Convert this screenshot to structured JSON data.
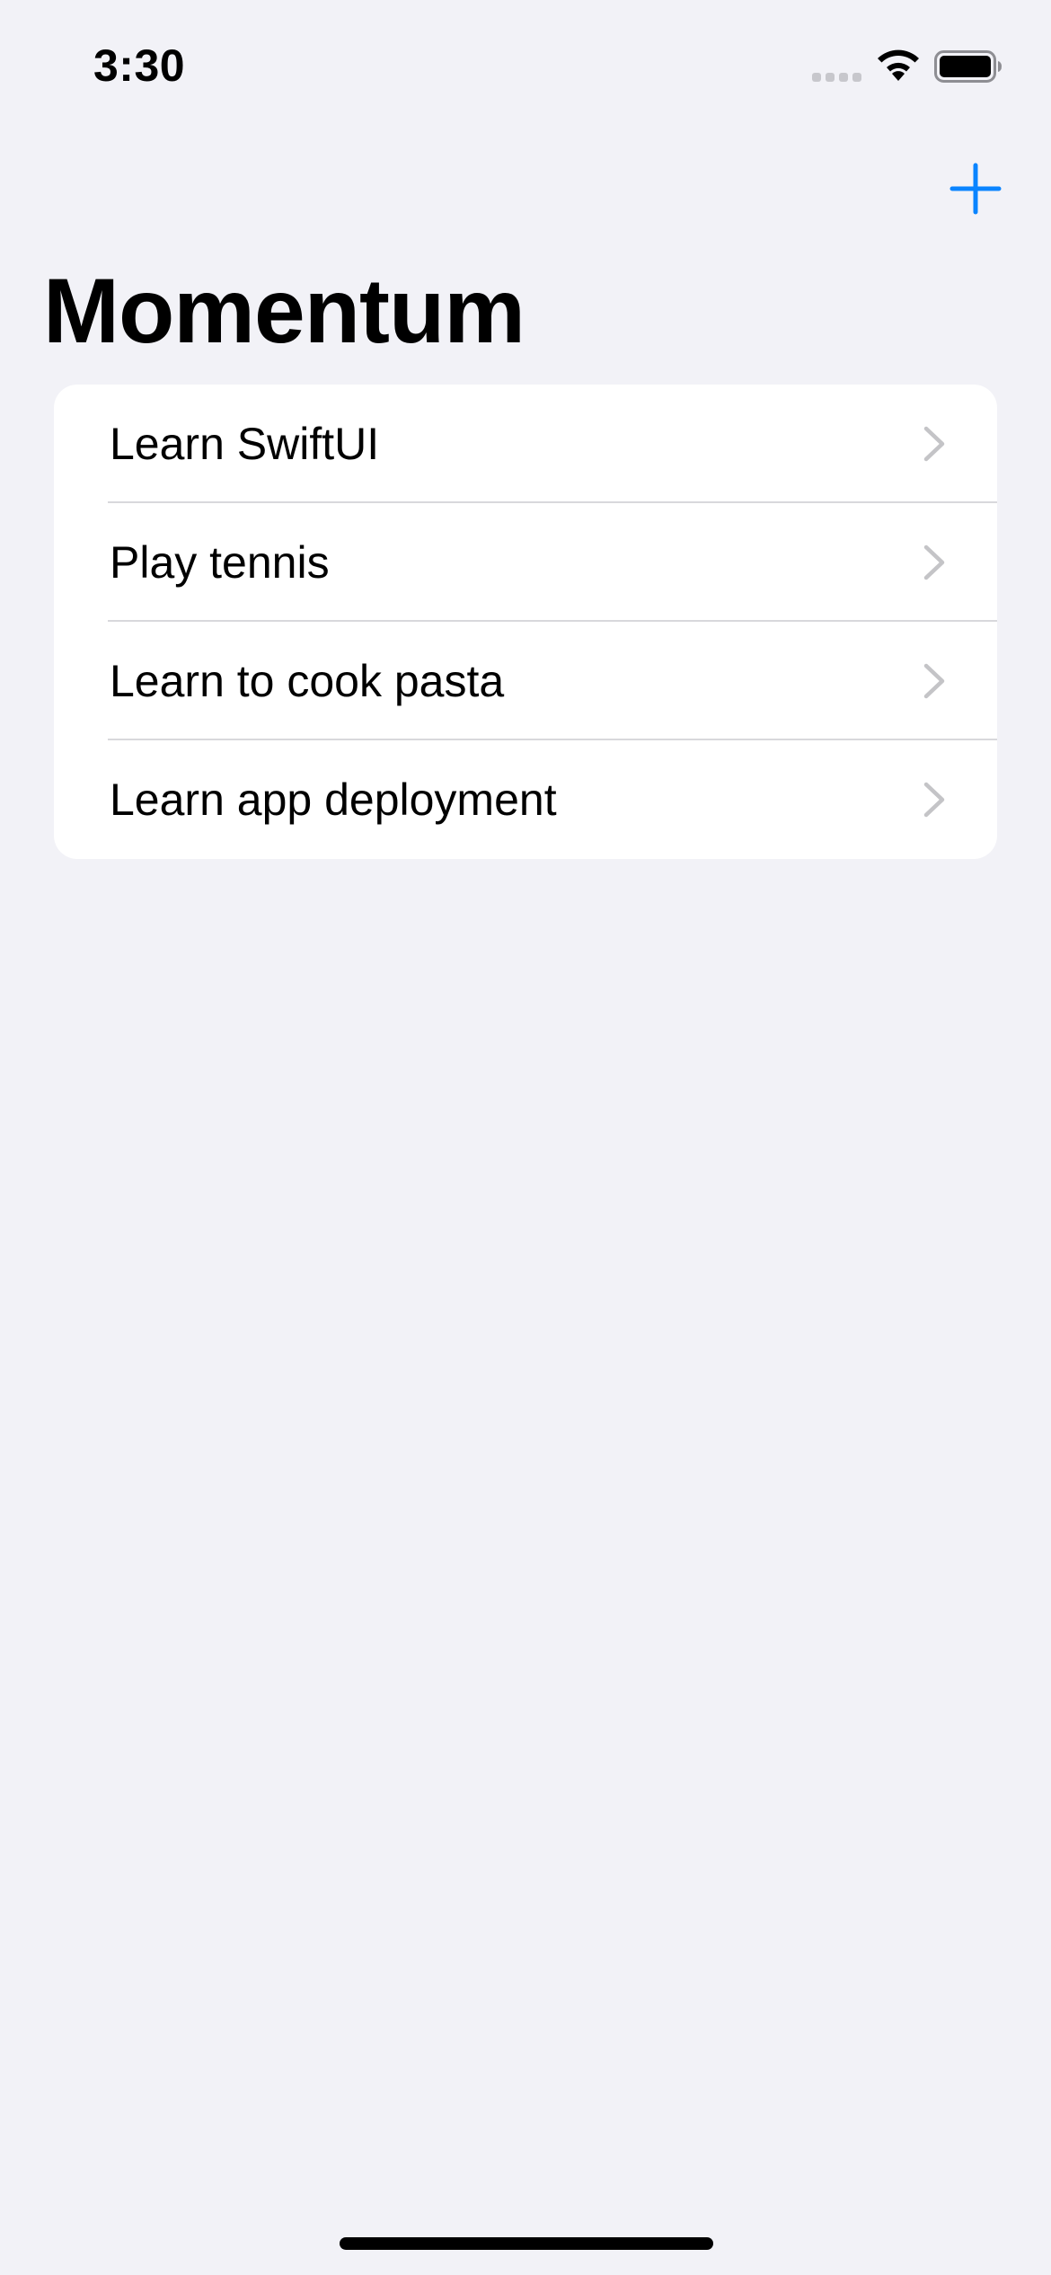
{
  "status_bar": {
    "time": "3:30"
  },
  "navigation": {
    "title": "Momentum",
    "add_icon": "plus-icon"
  },
  "goals": {
    "items": [
      {
        "label": "Learn SwiftUI"
      },
      {
        "label": "Play tennis"
      },
      {
        "label": "Learn to cook pasta"
      },
      {
        "label": "Learn app deployment"
      }
    ]
  },
  "colors": {
    "accent": "#0a84ff",
    "background": "#f2f2f7",
    "card": "#ffffff",
    "chevron": "#c4c4c7"
  }
}
